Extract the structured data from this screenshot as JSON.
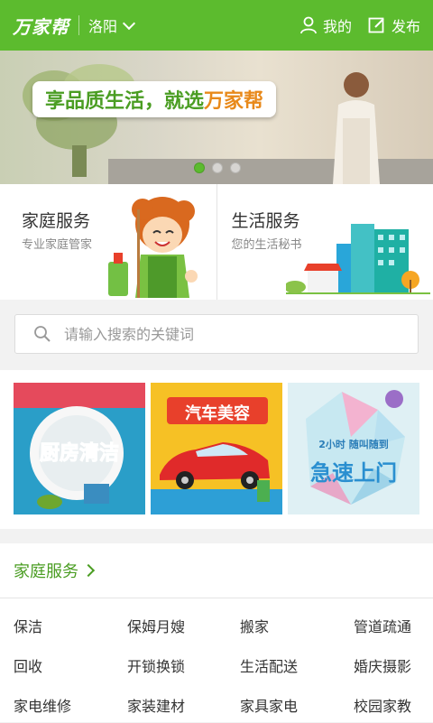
{
  "header": {
    "logo": "万家帮",
    "city": "洛阳",
    "mine_label": "我的",
    "publish_label": "发布"
  },
  "banner": {
    "slogan_main": "享品质生活，就选",
    "slogan_brand": "万家帮",
    "dots_count": 3,
    "active_dot": 1
  },
  "services": [
    {
      "title": "家庭服务",
      "subtitle": "专业家庭管家"
    },
    {
      "title": "生活服务",
      "subtitle": "您的生活秘书"
    }
  ],
  "search": {
    "placeholder": "请输入搜索的关键词"
  },
  "promos": [
    {
      "label": "厨房清洁"
    },
    {
      "label": "汽车美容"
    },
    {
      "small": "2小时 随叫随到",
      "label": "急速上门"
    }
  ],
  "category": {
    "title": "家庭服务",
    "items": [
      "保洁",
      "保姆月嫂",
      "搬家",
      "管道疏通",
      "回收",
      "开锁换锁",
      "生活配送",
      "婚庆摄影",
      "家电维修",
      "家装建材",
      "家具家电",
      "校园家教"
    ]
  },
  "colors": {
    "brand_green": "#5cbb2e",
    "text_green": "#4a9d22",
    "accent_orange": "#e8891a"
  }
}
